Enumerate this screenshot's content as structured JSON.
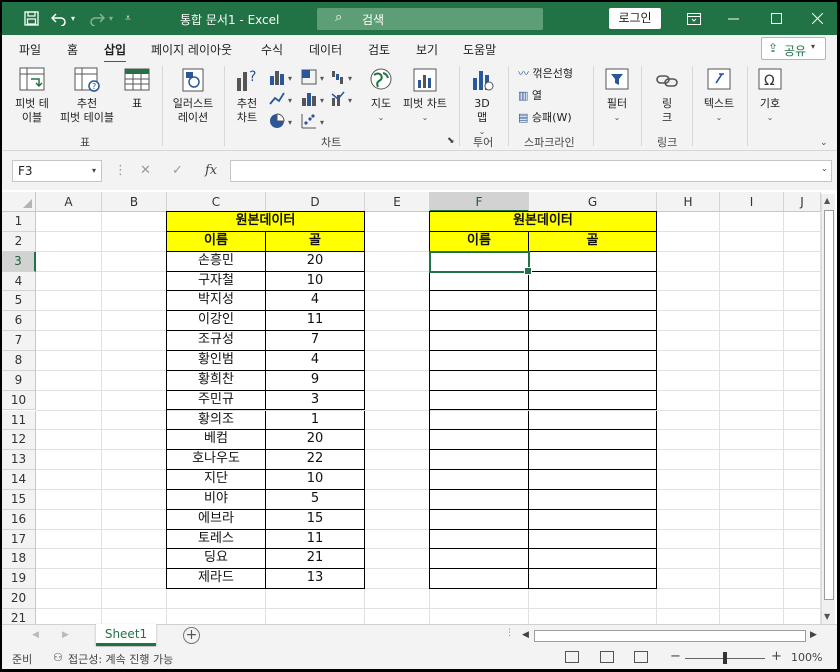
{
  "titlebar": {
    "doc_title": "통합 문서1  -  Excel",
    "search_label": "검색",
    "login_label": "로그인",
    "icons": [
      "save-icon",
      "undo-icon",
      "redo-icon",
      "customize-qat-icon",
      "ribbon-display-icon",
      "minimize-icon",
      "maximize-icon",
      "close-icon"
    ]
  },
  "tabs": [
    "파일",
    "홈",
    "삽입",
    "페이지 레이아웃",
    "수식",
    "데이터",
    "검토",
    "보기",
    "도움말"
  ],
  "active_tab": "삽입",
  "share_label": "공유",
  "ribbon": {
    "pivot_table": "피벗 테\n이블",
    "recommended_pivot": "추천\n피벗 테이블",
    "table": "표",
    "illustrations": "일러스트\n레이션",
    "recommended_charts": "추천\n차트",
    "map": "지도",
    "pivot_chart": "피벗 차트",
    "map3d": "3D\n맵",
    "sparkline_line": "꺾은선형",
    "sparkline_column": "열",
    "sparkline_winloss": "승패(W)",
    "filter": "필터",
    "link": "링\n크",
    "text": "텍스트",
    "symbol": "기호",
    "groups": {
      "table": "표",
      "chart": "차트",
      "tour": "투어",
      "sparkline": "스파크라인",
      "link": "링크"
    }
  },
  "formula_bar": {
    "name_box": "F3",
    "fx": "fx",
    "formula": ""
  },
  "columns": [
    "A",
    "B",
    "C",
    "D",
    "E",
    "F",
    "G",
    "H",
    "I",
    "J"
  ],
  "rows": [
    "1",
    "2",
    "3",
    "4",
    "5",
    "6",
    "7",
    "8",
    "9",
    "10",
    "11",
    "12",
    "13",
    "14",
    "15",
    "16",
    "17",
    "18",
    "19",
    "20",
    "21"
  ],
  "selected_column": "F",
  "selected_row": "3",
  "source_table": {
    "title": "원본데이터",
    "headers": [
      "이름",
      "골"
    ],
    "rows": [
      [
        "손흥민",
        "20"
      ],
      [
        "구자철",
        "10"
      ],
      [
        "박지성",
        "4"
      ],
      [
        "이강인",
        "11"
      ],
      [
        "조규성",
        "7"
      ],
      [
        "황인범",
        "4"
      ],
      [
        "황희찬",
        "9"
      ],
      [
        "주민규",
        "3"
      ],
      [
        "황의조",
        "1"
      ],
      [
        "베컴",
        "20"
      ],
      [
        "호나우도",
        "22"
      ],
      [
        "지단",
        "10"
      ],
      [
        "비야",
        "5"
      ],
      [
        "에브라",
        "15"
      ],
      [
        "토레스",
        "11"
      ],
      [
        "딩요",
        "21"
      ],
      [
        "제라드",
        "13"
      ]
    ]
  },
  "target_table": {
    "title": "원본데이터",
    "headers": [
      "이름",
      "골"
    ]
  },
  "sheet_tab": "Sheet1",
  "status": {
    "ready": "준비",
    "accessibility": "접근성: 계속 진행 가능",
    "zoom": "100%"
  },
  "colors": {
    "accent": "#217346",
    "header_fill": "#FFFF00"
  }
}
